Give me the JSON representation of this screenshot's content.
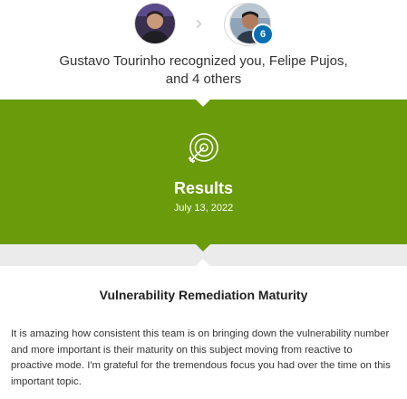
{
  "recognition": {
    "giver_name": "Gustavo Tourinho",
    "verb": " recognized ",
    "you": "you",
    "separator": ", ",
    "recipient": "Felipe Pujos",
    "and": ",",
    "and_word": "and ",
    "others_count": "4",
    "others_word": " others",
    "recipient_count_badge": "6"
  },
  "banner": {
    "icon": "target-icon",
    "title": "Results",
    "date": "July 13, 2022",
    "color": "#6a9b0a"
  },
  "card": {
    "title": "Vulnerability Remediation Maturity",
    "body": "It is amazing how consistent this team is on bringing down the vulnerability number and more important is their maturity on this subject moving from reactive to proactive mode. I'm grateful for the tremendous focus you had over the time on this important topic."
  },
  "colors": {
    "badge": "#0a6fb4",
    "strip": "#ebebeb"
  }
}
